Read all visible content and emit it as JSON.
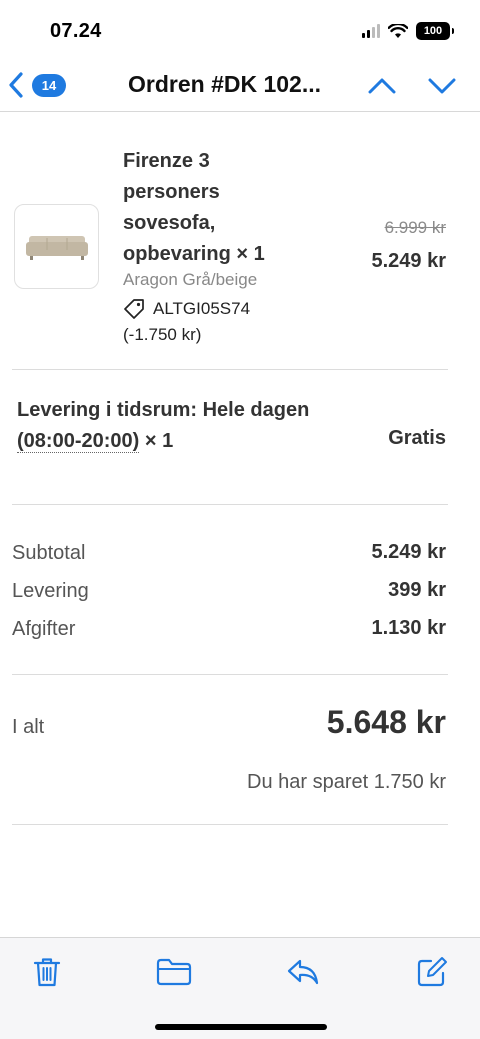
{
  "status_bar": {
    "time": "07.24",
    "battery": "100"
  },
  "nav": {
    "unread_count": "14",
    "title": "Ordren #DK 102...",
    "accent_color": "#1f7ae0"
  },
  "product": {
    "name": "Firenze 3 personers sovesofa, opbevaring × 1",
    "variant": "Aragon Grå/beige",
    "discount_code": "ALTGI05S74",
    "discount_amount": "(-1.750 kr)",
    "price_original": "6.999 kr",
    "price_current": "5.249 kr"
  },
  "delivery": {
    "label_prefix": "Levering i tidsrum: Hele dagen",
    "time_range": "(08:00-20:00)",
    "quantity": "× 1",
    "price": "Gratis"
  },
  "summary": {
    "rows": [
      {
        "label": "Subtotal",
        "value": "5.249 kr"
      },
      {
        "label": "Levering",
        "value": "399 kr"
      },
      {
        "label": "Afgifter",
        "value": "1.130 kr"
      }
    ]
  },
  "total": {
    "label": "I alt",
    "value": "5.648 kr",
    "saved_text": "Du har sparet 1.750 kr"
  },
  "toolbar": {
    "icons": [
      "trash-icon",
      "folder-icon",
      "reply-icon",
      "compose-icon"
    ]
  }
}
